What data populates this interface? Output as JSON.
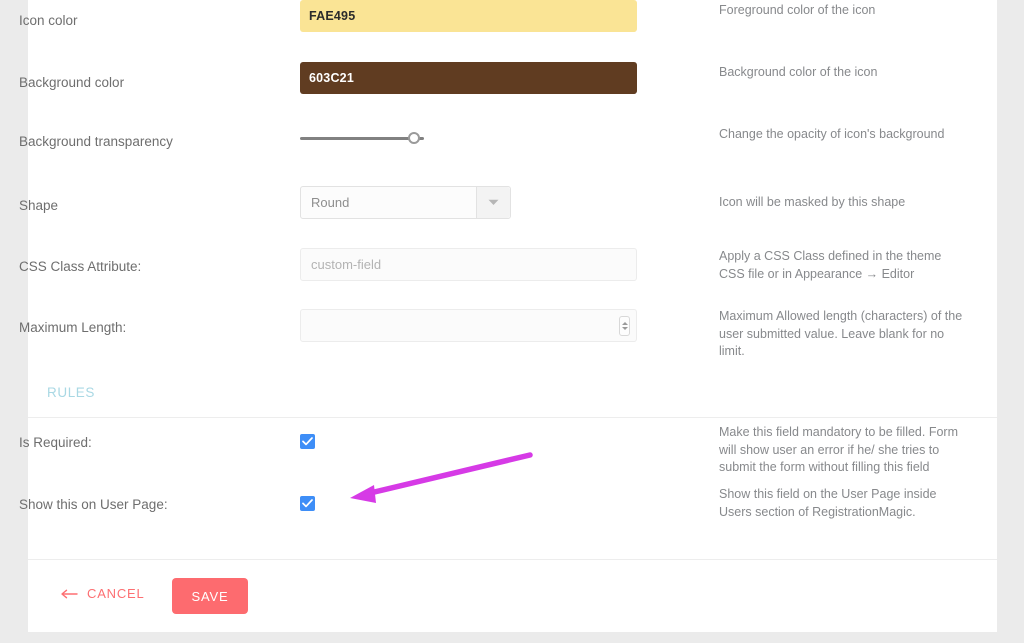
{
  "form": {
    "rows": [
      {
        "label": "Icon color",
        "control": "color",
        "value": "FAE495",
        "swatch": "#fae495",
        "text_tone": "light",
        "help": "Foreground color of the icon"
      },
      {
        "label": "Background color",
        "control": "color",
        "value": "603C21",
        "swatch": "#603c21",
        "text_tone": "dark",
        "help": "Background color of the icon"
      },
      {
        "label": "Background transparency",
        "control": "slider",
        "value": "",
        "help": "Change the opacity of icon's background"
      },
      {
        "label": "Shape",
        "control": "select",
        "value": "Round",
        "help": "Icon will be masked by this shape"
      },
      {
        "label": "CSS Class Attribute:",
        "control": "text",
        "value": "",
        "placeholder": "custom-field",
        "help": "Apply a CSS Class defined in the theme CSS file or in Appearance → Editor"
      },
      {
        "label": "Maximum Length:",
        "control": "number",
        "value": "",
        "placeholder": "",
        "help": "Maximum Allowed length (characters) of the user submitted value. Leave blank for no limit."
      }
    ]
  },
  "rules": {
    "title": "RULES",
    "rows": [
      {
        "label": "Is Required:",
        "checked": true,
        "help": "Make this field mandatory to be filled. Form will show user an error if he/ she tries to submit the form without filling this field"
      },
      {
        "label": "Show this on User Page:",
        "checked": true,
        "help": "Show this field on the User Page inside Users section of RegistrationMagic."
      }
    ]
  },
  "actions": {
    "cancel_label": "CANCEL",
    "cancel_icon": "arrow-left-icon",
    "save_label": "SAVE"
  },
  "annotation": {
    "type": "arrow",
    "color": "#d63ae6",
    "points_to": "show-on-user-page-checkbox"
  },
  "colors": {
    "accent_save": "#fd6b6f",
    "accent_cancel": "#fd6f72",
    "checkbox_blue": "#3e8ef7",
    "section_title": "#a9d8e4",
    "page_background": "#ebebeb",
    "card_background": "#ffffff"
  }
}
